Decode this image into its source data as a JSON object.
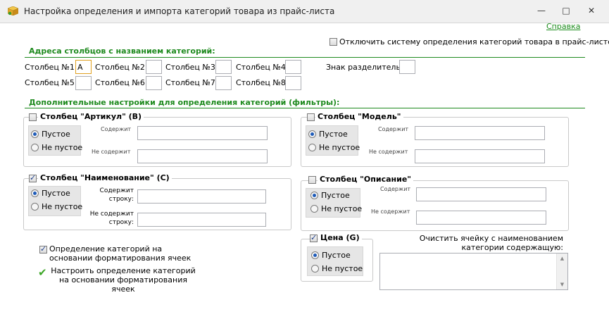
{
  "window": {
    "title": "Настройка определения и импорта категорий товара из прайс-листа",
    "icon": "box-app-icon",
    "minimize_glyph": "—",
    "maximize_glyph": "□",
    "close_glyph": "✕"
  },
  "help_link": "Справка",
  "disable_system": {
    "label": "Отключить систему определения категорий товара в прайс-листе",
    "checked": false
  },
  "columns_section": {
    "title": "Адреса столбцов с названием категорий:",
    "fields": [
      {
        "label": "Столбец №1:",
        "value": "A"
      },
      {
        "label": "Столбец №2:",
        "value": ""
      },
      {
        "label": "Столбец №3:",
        "value": ""
      },
      {
        "label": "Столбец №4:",
        "value": ""
      },
      {
        "label": "Столбец №5:",
        "value": ""
      },
      {
        "label": "Столбец №6:",
        "value": ""
      },
      {
        "label": "Столбец №7:",
        "value": ""
      },
      {
        "label": "Столбец №8:",
        "value": ""
      }
    ],
    "separator_label": "Знак разделитель:",
    "separator_value": ""
  },
  "filters_section": {
    "title": "Дополнительные настройки для определения категорий (фильтры):",
    "article": {
      "title": "Столбец \"Артикул\" (B)",
      "checked": false,
      "opt_empty": "Пустое",
      "opt_not_empty": "Не пустое",
      "contains": "Содержит",
      "not_contains": "Не содержит"
    },
    "model": {
      "title": "Столбец \"Модель\"",
      "checked": false,
      "opt_empty": "Пустое",
      "opt_not_empty": "Не пустое",
      "contains": "Содержит",
      "not_contains": "Не содержит"
    },
    "name": {
      "title": "Столбец \"Наименование\" (C)",
      "checked": true,
      "opt_empty": "Пустое",
      "opt_not_empty": "Не пустое",
      "contains": "Содержит строку:",
      "not_contains": "Не содержит строку:"
    },
    "description": {
      "title": "Столбец \"Описание\"",
      "checked": false,
      "opt_empty": "Пустое",
      "opt_not_empty": "Не пустое",
      "contains": "Содержит",
      "not_contains": "Не содержит"
    },
    "price": {
      "title": "Цена (G)",
      "checked": true,
      "opt_empty": "Пустое",
      "opt_not_empty": "Не пустое"
    }
  },
  "format_detection": {
    "label": "Определение категорий на основании форматирования ячеек",
    "checked": true
  },
  "configure_format": {
    "label": "Настроить определение категорий на основании форматирования ячеек",
    "icon": "green-check-icon"
  },
  "clear_cell": {
    "label": "Очистить ячейку с наименованием категории содержащую:",
    "value": ""
  }
}
